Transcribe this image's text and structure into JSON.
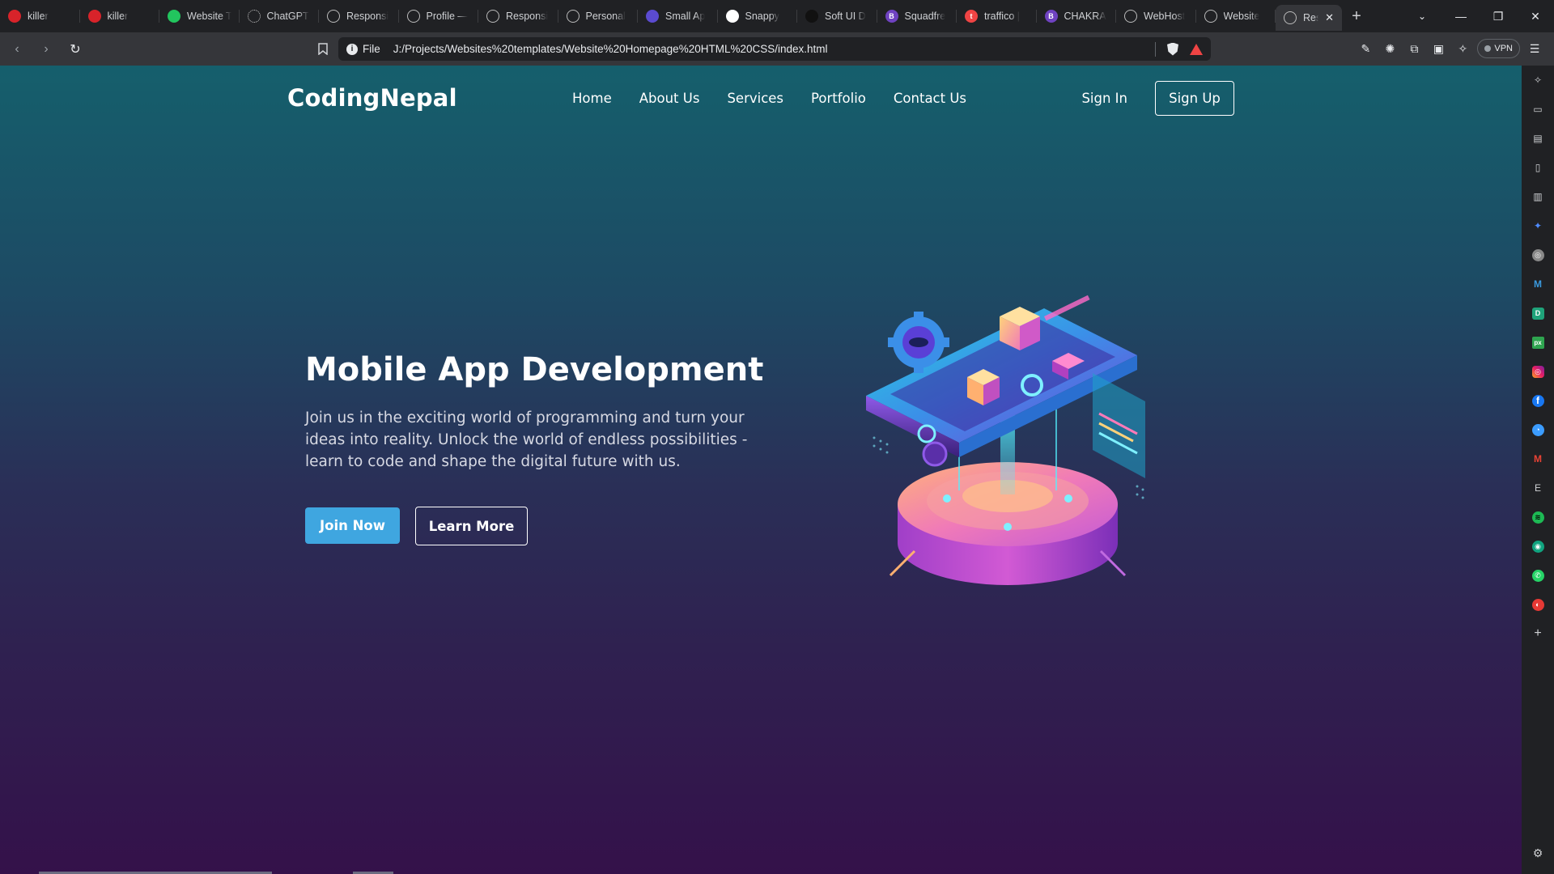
{
  "browser": {
    "tabs": [
      {
        "label": "killer",
        "favicon": "opera-icon"
      },
      {
        "label": "killer",
        "favicon": "opera-icon"
      },
      {
        "label": "Website T",
        "favicon": "green-square-icon"
      },
      {
        "label": "ChatGPT",
        "favicon": "chatgpt-icon"
      },
      {
        "label": "Responsi",
        "favicon": "globe-icon"
      },
      {
        "label": "Profile —",
        "favicon": "globe-icon"
      },
      {
        "label": "Responsi",
        "favicon": "globe-icon"
      },
      {
        "label": "Personal",
        "favicon": "globe-icon"
      },
      {
        "label": "Small Ap",
        "favicon": "purple-square-icon"
      },
      {
        "label": "Snappy",
        "favicon": "snappy-icon"
      },
      {
        "label": "Soft UI D",
        "favicon": "softui-icon"
      },
      {
        "label": "Squadfre",
        "favicon": "b-icon"
      },
      {
        "label": "traffico |",
        "favicon": "t-icon"
      },
      {
        "label": "CHAKRA",
        "favicon": "b-icon"
      },
      {
        "label": "WebHost",
        "favicon": "globe-icon"
      },
      {
        "label": "Website",
        "favicon": "globe-icon"
      }
    ],
    "active_tab": {
      "label": "Resp",
      "favicon": "globe-icon"
    },
    "omnibox": {
      "scheme_label": "File",
      "url": "J:/Projects/Websites%20templates/Website%20Homepage%20HTML%20CSS/index.html"
    },
    "vpn_label": "VPN"
  },
  "site": {
    "logo": "CodingNepal",
    "nav": [
      "Home",
      "About Us",
      "Services",
      "Portfolio",
      "Contact Us"
    ],
    "signin_label": "Sign In",
    "signup_label": "Sign Up",
    "hero": {
      "title": "Mobile App Development",
      "description": "Join us in the exciting world of programming and turn your ideas into reality. Unlock the world of endless possibilities - learn to code and shape the digital future with us.",
      "join_label": "Join Now",
      "learn_label": "Learn More"
    }
  },
  "colors": {
    "accent_button": "#3fa6e0",
    "gradient_top": "#155f6c",
    "gradient_bottom": "#34114a"
  }
}
